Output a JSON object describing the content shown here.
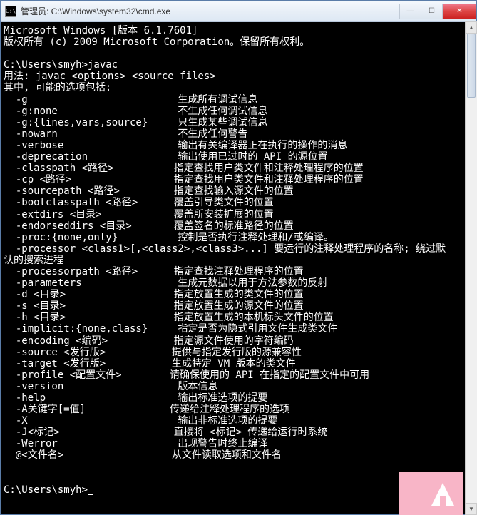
{
  "title": "管理员: C:\\Windows\\system32\\cmd.exe",
  "icon_text": "C:\\",
  "header_lines": [
    "Microsoft Windows [版本 6.1.7601]",
    "版权所有 (c) 2009 Microsoft Corporation。保留所有权利。",
    "",
    "C:\\Users\\smyh>javac",
    "用法: javac <options> <source files>",
    "其中, 可能的选项包括:"
  ],
  "options": [
    {
      "flag": "-g",
      "desc": "生成所有调试信息"
    },
    {
      "flag": "-g:none",
      "desc": "不生成任何调试信息"
    },
    {
      "flag": "-g:{lines,vars,source}",
      "desc": "只生成某些调试信息"
    },
    {
      "flag": "-nowarn",
      "desc": "不生成任何警告"
    },
    {
      "flag": "-verbose",
      "desc": "输出有关编译器正在执行的操作的消息"
    },
    {
      "flag": "-deprecation",
      "desc": "输出使用已过时的 API 的源位置"
    },
    {
      "flag": "-classpath <路径>",
      "desc": "指定查找用户类文件和注释处理程序的位置"
    },
    {
      "flag": "-cp <路径>",
      "desc": "指定查找用户类文件和注释处理程序的位置"
    },
    {
      "flag": "-sourcepath <路径>",
      "desc": "指定查找输入源文件的位置"
    },
    {
      "flag": "-bootclasspath <路径>",
      "desc": "覆盖引导类文件的位置"
    },
    {
      "flag": "-extdirs <目录>",
      "desc": "覆盖所安装扩展的位置"
    },
    {
      "flag": "-endorseddirs <目录>",
      "desc": "覆盖签名的标准路径的位置"
    },
    {
      "flag": "-proc:{none,only}",
      "desc": "控制是否执行注释处理和/或编译。"
    },
    {
      "flag": "-processor <class1>[,<class2>,<class3>...] 要运行的注释处理程序的名称; 绕过默",
      "desc": null
    }
  ],
  "continuation_line": "认的搜索进程",
  "options2": [
    {
      "flag": "-processorpath <路径>",
      "desc": "指定查找注释处理程序的位置"
    },
    {
      "flag": "-parameters",
      "desc": "生成元数据以用于方法参数的反射"
    },
    {
      "flag": "-d <目录>",
      "desc": "指定放置生成的类文件的位置"
    },
    {
      "flag": "-s <目录>",
      "desc": "指定放置生成的源文件的位置"
    },
    {
      "flag": "-h <目录>",
      "desc": "指定放置生成的本机标头文件的位置"
    },
    {
      "flag": "-implicit:{none,class}",
      "desc": "指定是否为隐式引用文件生成类文件"
    },
    {
      "flag": "-encoding <编码>",
      "desc": "指定源文件使用的字符编码"
    },
    {
      "flag": "-source <发行版>",
      "desc": "提供与指定发行版的源兼容性"
    },
    {
      "flag": "-target <发行版>",
      "desc": "生成特定 VM 版本的类文件"
    },
    {
      "flag": "-profile <配置文件>",
      "desc": "请确保使用的 API 在指定的配置文件中可用"
    },
    {
      "flag": "-version",
      "desc": "版本信息"
    },
    {
      "flag": "-help",
      "desc": "输出标准选项的提要"
    },
    {
      "flag": "-A关键字[=值]",
      "desc": "传递给注释处理程序的选项"
    },
    {
      "flag": "-X",
      "desc": "输出非标准选项的提要"
    },
    {
      "flag": "-J<标记>",
      "desc": "直接将 <标记> 传递给运行时系统"
    },
    {
      "flag": "-Werror",
      "desc": "出现警告时终止编译"
    },
    {
      "flag": "@<文件名>",
      "desc": "从文件读取选项和文件名"
    }
  ],
  "prompt": "C:\\Users\\smyh>",
  "flag_col_width": 27,
  "buttons": {
    "min": "—",
    "max": "☐",
    "close": "✕"
  }
}
